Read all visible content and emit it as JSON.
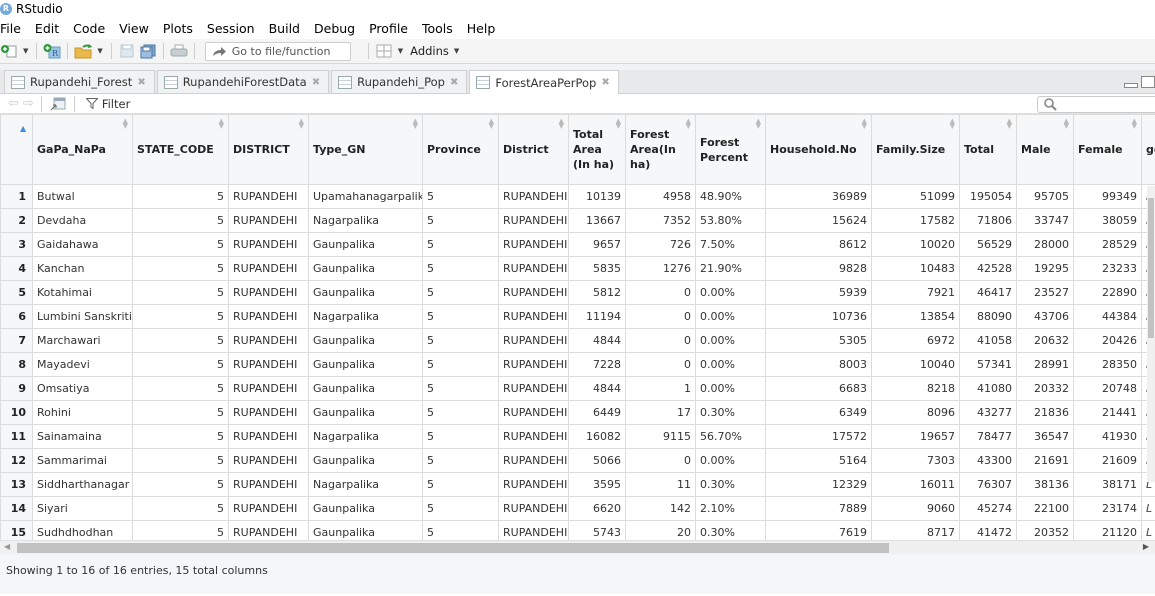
{
  "app": {
    "title": "RStudio"
  },
  "menu": [
    "File",
    "Edit",
    "Code",
    "View",
    "Plots",
    "Session",
    "Build",
    "Debug",
    "Profile",
    "Tools",
    "Help"
  ],
  "toolbar": {
    "goto_placeholder": "Go to file/function",
    "addins_label": "Addins"
  },
  "tabs": [
    {
      "label": "Rupandehi_Forest",
      "active": false
    },
    {
      "label": "RupandehiForestData",
      "active": false
    },
    {
      "label": "Rupandehi_Pop",
      "active": false
    },
    {
      "label": "ForestAreaPerPop",
      "active": true
    }
  ],
  "viewer": {
    "filter_label": "Filter",
    "search_value": ""
  },
  "table": {
    "columns": [
      "GaPa_NaPa",
      "STATE_CODE",
      "DISTRICT",
      "Type_GN",
      "Province",
      "District",
      "Total Area (In ha)",
      "Forest Area(In ha)",
      "Forest Percent",
      "Household.No",
      "Family.Size",
      "Total",
      "Male",
      "Female",
      "ge"
    ],
    "rows": [
      [
        "1",
        "Butwal",
        "5",
        "RUPANDEHI",
        "Upamahanagarpalika",
        "5",
        "RUPANDEHI",
        "10139",
        "4958",
        "48.90%",
        "36989",
        "51099",
        "195054",
        "95705",
        "99349",
        "L"
      ],
      [
        "2",
        "Devdaha",
        "5",
        "RUPANDEHI",
        "Nagarpalika",
        "5",
        "RUPANDEHI",
        "13667",
        "7352",
        "53.80%",
        "15624",
        "17582",
        "71806",
        "33747",
        "38059",
        "L"
      ],
      [
        "3",
        "Gaidahawa",
        "5",
        "RUPANDEHI",
        "Gaunpalika",
        "5",
        "RUPANDEHI",
        "9657",
        "726",
        "7.50%",
        "8612",
        "10020",
        "56529",
        "28000",
        "28529",
        "L"
      ],
      [
        "4",
        "Kanchan",
        "5",
        "RUPANDEHI",
        "Gaunpalika",
        "5",
        "RUPANDEHI",
        "5835",
        "1276",
        "21.90%",
        "9828",
        "10483",
        "42528",
        "19295",
        "23233",
        "L"
      ],
      [
        "5",
        "Kotahimai",
        "5",
        "RUPANDEHI",
        "Gaunpalika",
        "5",
        "RUPANDEHI",
        "5812",
        "0",
        "0.00%",
        "5939",
        "7921",
        "46417",
        "23527",
        "22890",
        "L"
      ],
      [
        "6",
        "Lumbini Sanskritik",
        "5",
        "RUPANDEHI",
        "Nagarpalika",
        "5",
        "RUPANDEHI",
        "11194",
        "0",
        "0.00%",
        "10736",
        "13854",
        "88090",
        "43706",
        "44384",
        "L"
      ],
      [
        "7",
        "Marchawari",
        "5",
        "RUPANDEHI",
        "Gaunpalika",
        "5",
        "RUPANDEHI",
        "4844",
        "0",
        "0.00%",
        "5305",
        "6972",
        "41058",
        "20632",
        "20426",
        "L"
      ],
      [
        "8",
        "Mayadevi",
        "5",
        "RUPANDEHI",
        "Gaunpalika",
        "5",
        "RUPANDEHI",
        "7228",
        "0",
        "0.00%",
        "8003",
        "10040",
        "57341",
        "28991",
        "28350",
        "L"
      ],
      [
        "9",
        "Omsatiya",
        "5",
        "RUPANDEHI",
        "Gaunpalika",
        "5",
        "RUPANDEHI",
        "4844",
        "1",
        "0.00%",
        "6683",
        "8218",
        "41080",
        "20332",
        "20748",
        "L"
      ],
      [
        "10",
        "Rohini",
        "5",
        "RUPANDEHI",
        "Gaunpalika",
        "5",
        "RUPANDEHI",
        "6449",
        "17",
        "0.30%",
        "6349",
        "8096",
        "43277",
        "21836",
        "21441",
        "L"
      ],
      [
        "11",
        "Sainamaina",
        "5",
        "RUPANDEHI",
        "Nagarpalika",
        "5",
        "RUPANDEHI",
        "16082",
        "9115",
        "56.70%",
        "17572",
        "19657",
        "78477",
        "36547",
        "41930",
        "L"
      ],
      [
        "12",
        "Sammarimai",
        "5",
        "RUPANDEHI",
        "Gaunpalika",
        "5",
        "RUPANDEHI",
        "5066",
        "0",
        "0.00%",
        "5164",
        "7303",
        "43300",
        "21691",
        "21609",
        "L"
      ],
      [
        "13",
        "Siddharthanagar",
        "5",
        "RUPANDEHI",
        "Nagarpalika",
        "5",
        "RUPANDEHI",
        "3595",
        "11",
        "0.30%",
        "12329",
        "16011",
        "76307",
        "38136",
        "38171",
        "L"
      ],
      [
        "14",
        "Siyari",
        "5",
        "RUPANDEHI",
        "Gaunpalika",
        "5",
        "RUPANDEHI",
        "6620",
        "142",
        "2.10%",
        "7889",
        "9060",
        "45274",
        "22100",
        "23174",
        "L"
      ],
      [
        "15",
        "Sudhdhodhan",
        "5",
        "RUPANDEHI",
        "Gaunpalika",
        "5",
        "RUPANDEHI",
        "5743",
        "20",
        "0.30%",
        "7619",
        "8717",
        "41472",
        "20352",
        "21120",
        "L"
      ]
    ]
  },
  "status": {
    "text": "Showing 1 to 16 of 16 entries, 15 total columns"
  }
}
